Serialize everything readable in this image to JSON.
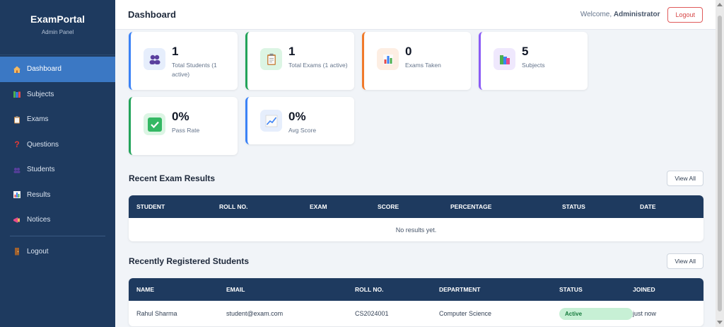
{
  "sidebar": {
    "brand": "ExamPortal",
    "subtitle": "Admin Panel",
    "items": [
      {
        "label": "Dashboard",
        "icon": "house-icon"
      },
      {
        "label": "Subjects",
        "icon": "books-icon"
      },
      {
        "label": "Exams",
        "icon": "clipboard-icon"
      },
      {
        "label": "Questions",
        "icon": "question-icon"
      },
      {
        "label": "Students",
        "icon": "users-icon"
      },
      {
        "label": "Results",
        "icon": "bar-chart-icon"
      },
      {
        "label": "Notices",
        "icon": "megaphone-icon"
      }
    ],
    "logout": "Logout",
    "active_color": "#3b78c4",
    "bg_color": "#1e3a5f"
  },
  "header": {
    "title": "Dashboard",
    "welcome_prefix": "Welcome,",
    "user": "Administrator",
    "logout": "Logout"
  },
  "stats": [
    {
      "value": "1",
      "label": "Total Students (1 active)",
      "accent": "#3b82f6",
      "icon": "users-icon"
    },
    {
      "value": "1",
      "label": "Total Exams (1 active)",
      "accent": "#22a35a",
      "icon": "clipboard-icon"
    },
    {
      "value": "0",
      "label": "Exams Taken",
      "accent": "#f07a2a",
      "icon": "bar-chart-icon"
    },
    {
      "value": "5",
      "label": "Subjects",
      "accent": "#8b5cf6",
      "icon": "books-icon"
    },
    {
      "value": "0%",
      "label": "Pass Rate",
      "accent": "#22a35a",
      "icon": "check-icon"
    },
    {
      "value": "0%",
      "label": "Avg Score",
      "accent": "#3b82f6",
      "icon": "trend-icon"
    }
  ],
  "recent_results": {
    "title": "Recent Exam Results",
    "view_all": "View All",
    "columns": [
      "STUDENT",
      "ROLL NO.",
      "EXAM",
      "SCORE",
      "PERCENTAGE",
      "STATUS",
      "DATE"
    ],
    "empty": "No results yet."
  },
  "recent_students": {
    "title": "Recently Registered Students",
    "view_all": "View All",
    "columns": [
      "NAME",
      "EMAIL",
      "ROLL NO.",
      "DEPARTMENT",
      "STATUS",
      "JOINED"
    ],
    "rows": [
      {
        "name": "Rahul Sharma",
        "email": "student@exam.com",
        "roll": "CS2024001",
        "department": "Computer Science",
        "status": "Active",
        "joined": "just now"
      }
    ]
  }
}
